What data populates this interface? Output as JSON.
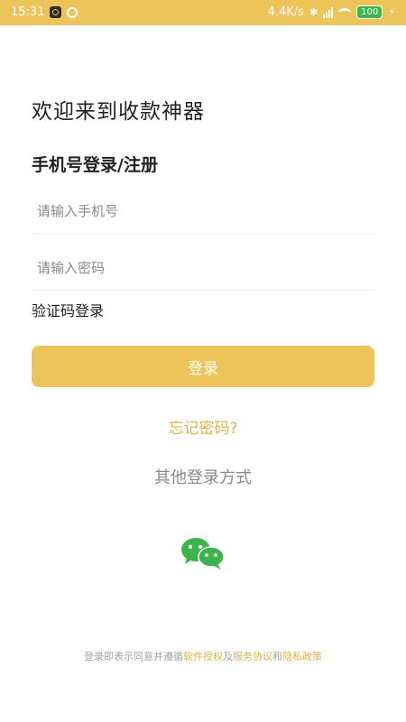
{
  "status_bar": {
    "time": "15:31",
    "network_speed": "4.4K/s",
    "battery": "100"
  },
  "welcome_title": "欢迎来到收款神器",
  "login_subtitle": "手机号登录/注册",
  "phone_input": {
    "placeholder": "请输入手机号",
    "value": ""
  },
  "password_input": {
    "placeholder": "请输入密码",
    "value": ""
  },
  "code_login_label": "验证码登录",
  "login_button_label": "登录",
  "forgot_password_label": "忘记密码?",
  "other_methods_label": "其他登录方式",
  "wechat_icon": "wechat-icon",
  "agreement": {
    "prefix": "登录即表示同意并遵循",
    "software_license": "软件授权",
    "and1": "及",
    "service_agreement": "服务协议",
    "and2": "和",
    "privacy_policy": "隐私政策"
  },
  "colors": {
    "accent": "#ecc45a",
    "link": "#e0b24a",
    "wechat_green": "#3bb54a"
  }
}
